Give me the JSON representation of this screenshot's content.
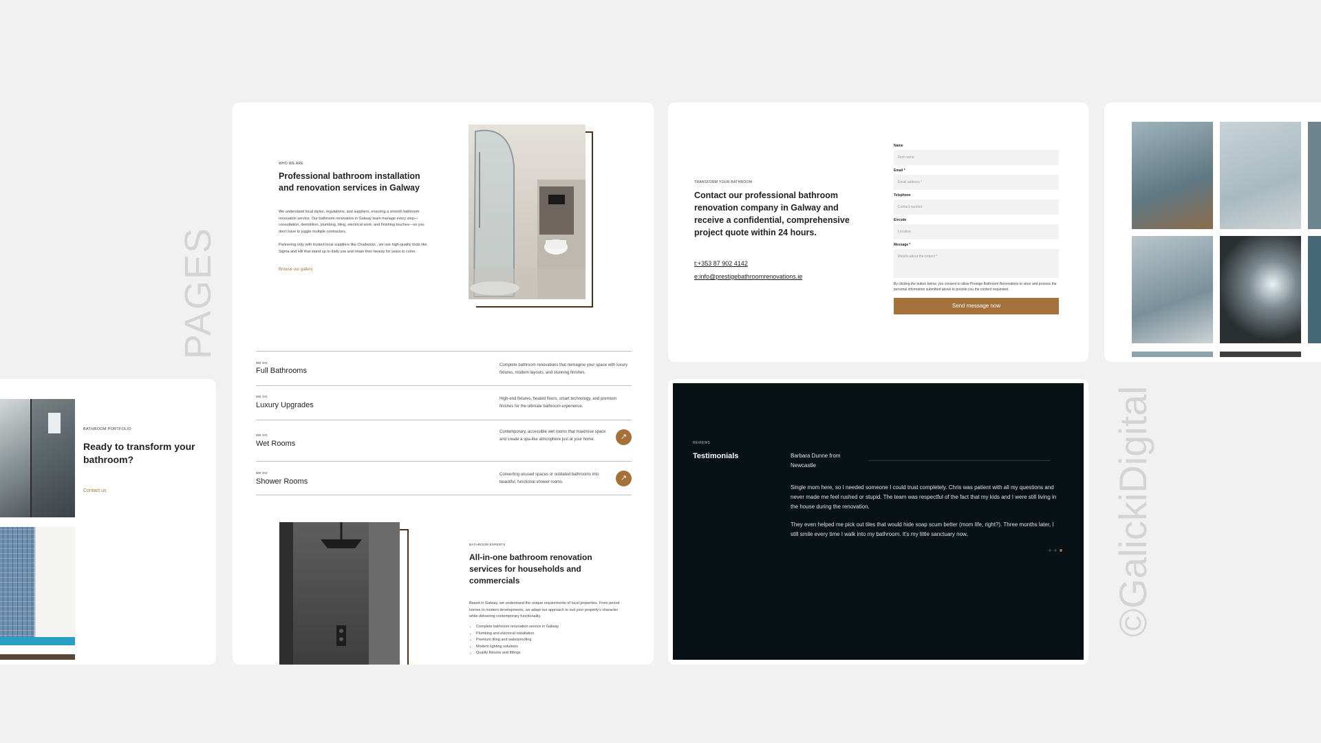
{
  "labels": {
    "pages": "PAGES",
    "watermark": "©GalickiDigital"
  },
  "about": {
    "eyebrow": "WHO WE ARE",
    "title": "Professional bathroom installation and renovation services in Galway",
    "para1": "We understand local styles, regulations, and suppliers, ensuring a smooth bathroom renovation service. Our bathroom renovators in Galway team manage every step—consultation, demolition, plumbing, tiling, electrical work, and finishing touches—so you don't have to juggle multiple contractors.",
    "para2": "Partnering only with trusted local suppliers like Chadwicks , we use high-quality tools like Sigma and Hill that stand up to daily use and retain their beauty for years to come.",
    "link": "Browse our gallery"
  },
  "services": [
    {
      "eyebrow": "WE DO",
      "title": "Full Bathrooms",
      "desc": "Complete bathroom renovations that reimagine your space with luxury fixtures, modern layouts, and stunning finishes.",
      "arrow": false
    },
    {
      "eyebrow": "WE DO",
      "title": "Luxury Upgrades",
      "desc": "High-end fixtures, heated floors, smart technology, and premium finishes for the ultimate bathroom experience.",
      "arrow": false
    },
    {
      "eyebrow": "WE DO",
      "title": "Wet Rooms",
      "desc": "Contemporary, accessible wet rooms that maximise space and create a spa-like atmosphere just at your home.",
      "arrow": true
    },
    {
      "eyebrow": "WE DO",
      "title": "Shower Rooms",
      "desc": "Converting unused spaces or outdated bathrooms into beautiful, functional shower rooms.",
      "arrow": true
    }
  ],
  "experts": {
    "eyebrow": "BATHROOM EXPERTS",
    "title": "All-in-one bathroom renovation services for households and commercials",
    "para": "Based in Galway, we understand the unique requirements of local properties. From period homes to modern developments, we adapt our approach to suit your property's character while delivering contemporary functionality.",
    "bullets": [
      "Complete bathroom renovation service in Galway",
      "Plumbing and electrical installation",
      "Premium tiling and waterproofing",
      "Modern lighting solutions",
      "Quality fixtures and fittings"
    ]
  },
  "contact": {
    "eyebrow": "TRANSFORM YOUR BATHROOM",
    "title": "Contact our professional bathroom renovation company in Galway and receive a confidential, comprehensive project quote within 24 hours.",
    "phone": "t:+353 87 902 4142",
    "email": "e:info@prestigebathroomrenovations.ie",
    "form": {
      "name_label": "Name",
      "name_placeholder": "First name",
      "email_label": "Email *",
      "email_placeholder": "Email address *",
      "telephone_label": "Telephone",
      "telephone_placeholder": "Contact number",
      "eircode_label": "Eircode",
      "eircode_placeholder": "Location",
      "message_label": "Message *",
      "message_placeholder": "Details about the project *",
      "consent": "By clicking the button below, you consent to allow Prestige Bathroom Renovations to store and process the personal information submitted above to provide you the content requested.",
      "submit": "Send message now"
    }
  },
  "portfolio": {
    "eyebrow": "BATHROOM PORTFOLIO",
    "title": "Ready to transform your bathroom?",
    "link": "Contact us"
  },
  "testimonials": {
    "eyebrow": "REVIEWS",
    "title": "Testimonials",
    "author": "Barbara Dunne from Newcastle",
    "p1": "Single mom here, so I needed someone I could trust completely. Chris was patient with all my questions and never made me feel rushed or stupid. The team was respectful of the fact that my kids and I were still living in the house during the renovation.",
    "p2": "They even helped me pick out tiles that would hide soap scum better (mom life, right?). Three months later, I still smile every time I walk into my bathroom. It's my little sanctuary now."
  },
  "colors": {
    "background": "#f1f1f1",
    "accent": "#a5713a",
    "dark": "#071116"
  }
}
